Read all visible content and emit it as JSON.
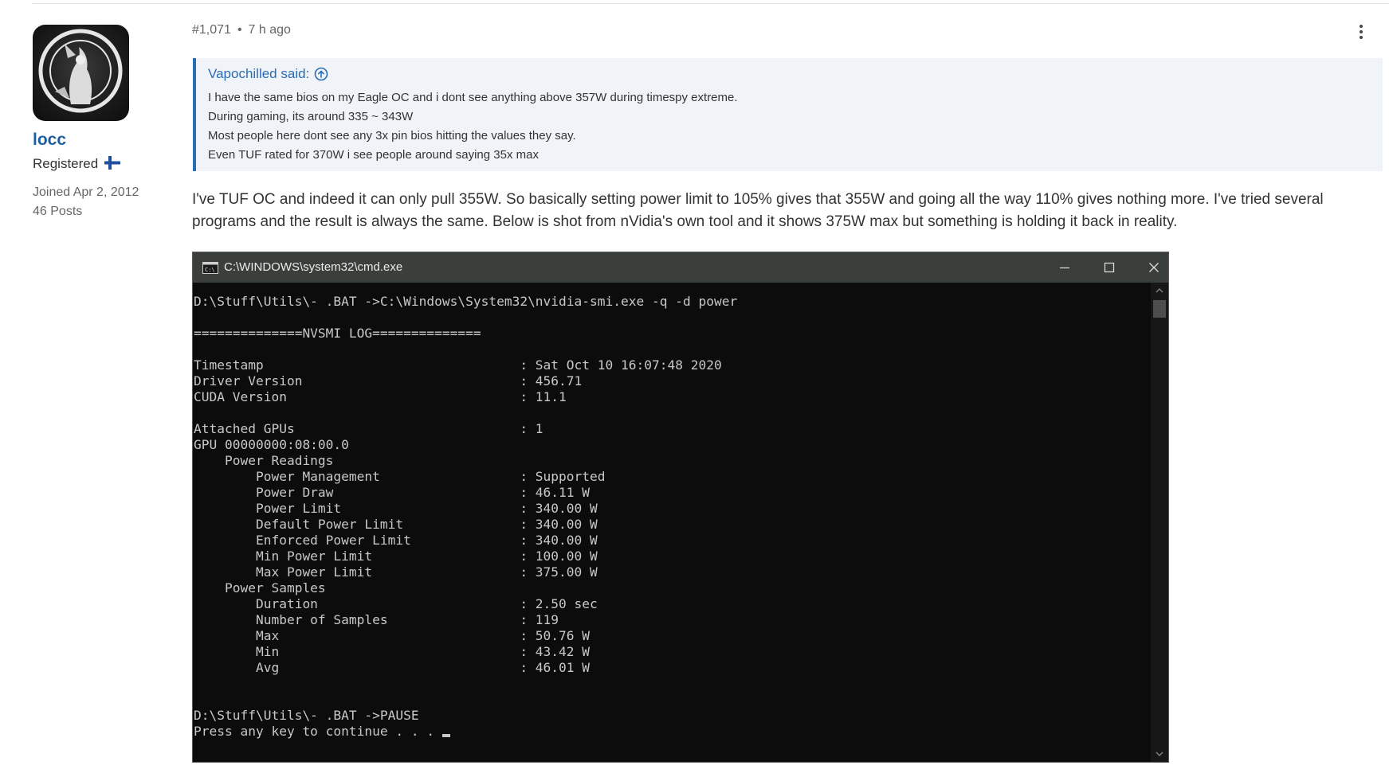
{
  "author": {
    "username": "locc",
    "role": "Registered",
    "joined": "Joined Apr 2, 2012",
    "posts": "46 Posts",
    "avatar_icon": "seal-avatar-icon",
    "flag_icon": "finland-flag-icon"
  },
  "post": {
    "number": "#1,071",
    "separator": "•",
    "time": "7 h ago",
    "menu_icon": "vertical-ellipsis-icon",
    "quote": {
      "author": "Vapochilled said:",
      "icon": "arrow-up-circle-icon",
      "lines": [
        "I have the same bios on my Eagle OC and i dont see anything above 357W during timespy extreme.",
        "During gaming, its around 335 ~ 343W",
        "Most people here dont see any 3x pin bios hitting the values they say.",
        "Even TUF rated for 370W i see people around saying 35x max"
      ]
    },
    "body": "I've TUF OC and indeed it can only pull 355W. So basically setting power limit to 105% gives that 355W and going all the way 110% gives nothing more. I've tried several programs and the result is always the same. Below is shot from nVidia's own tool and it shows 375W max but something is holding it back in reality."
  },
  "cmd_window": {
    "title": "C:\\WINDOWS\\system32\\cmd.exe",
    "icon": "cmd-icon",
    "colors": {
      "titlebar": "#3a3f3b",
      "background": "#0c0c0c",
      "text": "#c8c8c8"
    },
    "lines": [
      "D:\\Stuff\\Utils\\- .BAT ->C:\\Windows\\System32\\nvidia-smi.exe -q -d power",
      "",
      "==============NVSMI LOG==============",
      "",
      "Timestamp                                 : Sat Oct 10 16:07:48 2020",
      "Driver Version                            : 456.71",
      "CUDA Version                              : 11.1",
      "",
      "Attached GPUs                             : 1",
      "GPU 00000000:08:00.0",
      "    Power Readings",
      "        Power Management                  : Supported",
      "        Power Draw                        : 46.11 W",
      "        Power Limit                       : 340.00 W",
      "        Default Power Limit               : 340.00 W",
      "        Enforced Power Limit              : 340.00 W",
      "        Min Power Limit                   : 100.00 W",
      "        Max Power Limit                   : 375.00 W",
      "    Power Samples",
      "        Duration                          : 2.50 sec",
      "        Number of Samples                 : 119",
      "        Max                               : 50.76 W",
      "        Min                               : 43.42 W",
      "        Avg                               : 46.01 W",
      "",
      "",
      "D:\\Stuff\\Utils\\- .BAT ->PAUSE"
    ],
    "prompt_line": "Press any key to continue . . . "
  },
  "accent": "#2a6db5",
  "username_color": "#1f5f9f"
}
